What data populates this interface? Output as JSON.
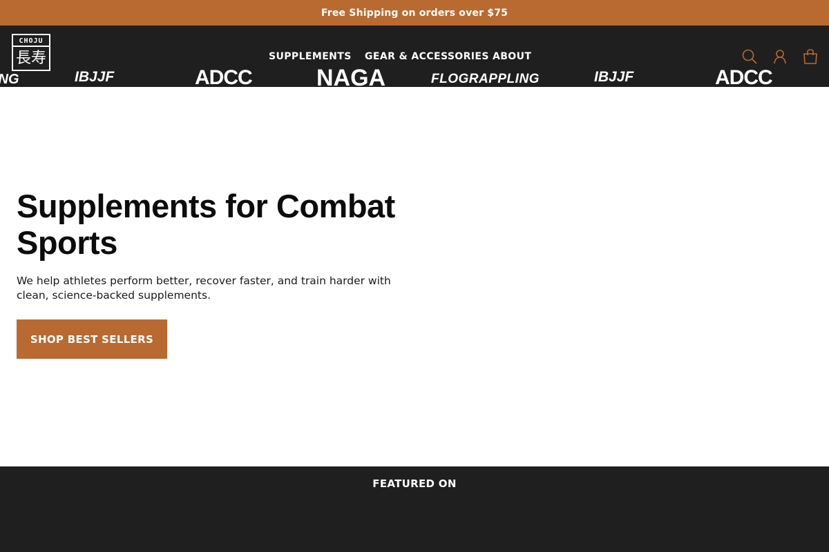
{
  "announcement": {
    "text": "Free Shipping on orders over $75"
  },
  "header": {
    "logo": {
      "top_text": "CHOJU",
      "kanji": "長寿"
    },
    "nav": [
      {
        "label": "SUPPLEMENTS"
      },
      {
        "label": "GEAR & ACCESSORIES"
      },
      {
        "label": "ABOUT"
      }
    ],
    "icons": {
      "search": "search-icon",
      "account": "account-icon",
      "cart": "cart-icon"
    }
  },
  "hero": {
    "title": "Supplements for Combat Sports",
    "subtitle": "We help athletes perform better, recover faster, and train harder with clean, science-backed supplements.",
    "cta_label": "SHOP BEST SELLERS"
  },
  "featured": {
    "title": "FEATURED ON",
    "brands": [
      {
        "label": "ING"
      },
      {
        "label": "IBJJF"
      },
      {
        "label": "ADCC"
      },
      {
        "label": "NAGA"
      },
      {
        "label": "FLOGRAPPLING"
      },
      {
        "label": "IBJJF"
      },
      {
        "label": "ADCC"
      }
    ]
  },
  "colors": {
    "accent": "#b96a31",
    "dark": "#1f1f1f",
    "white": "#ffffff"
  }
}
